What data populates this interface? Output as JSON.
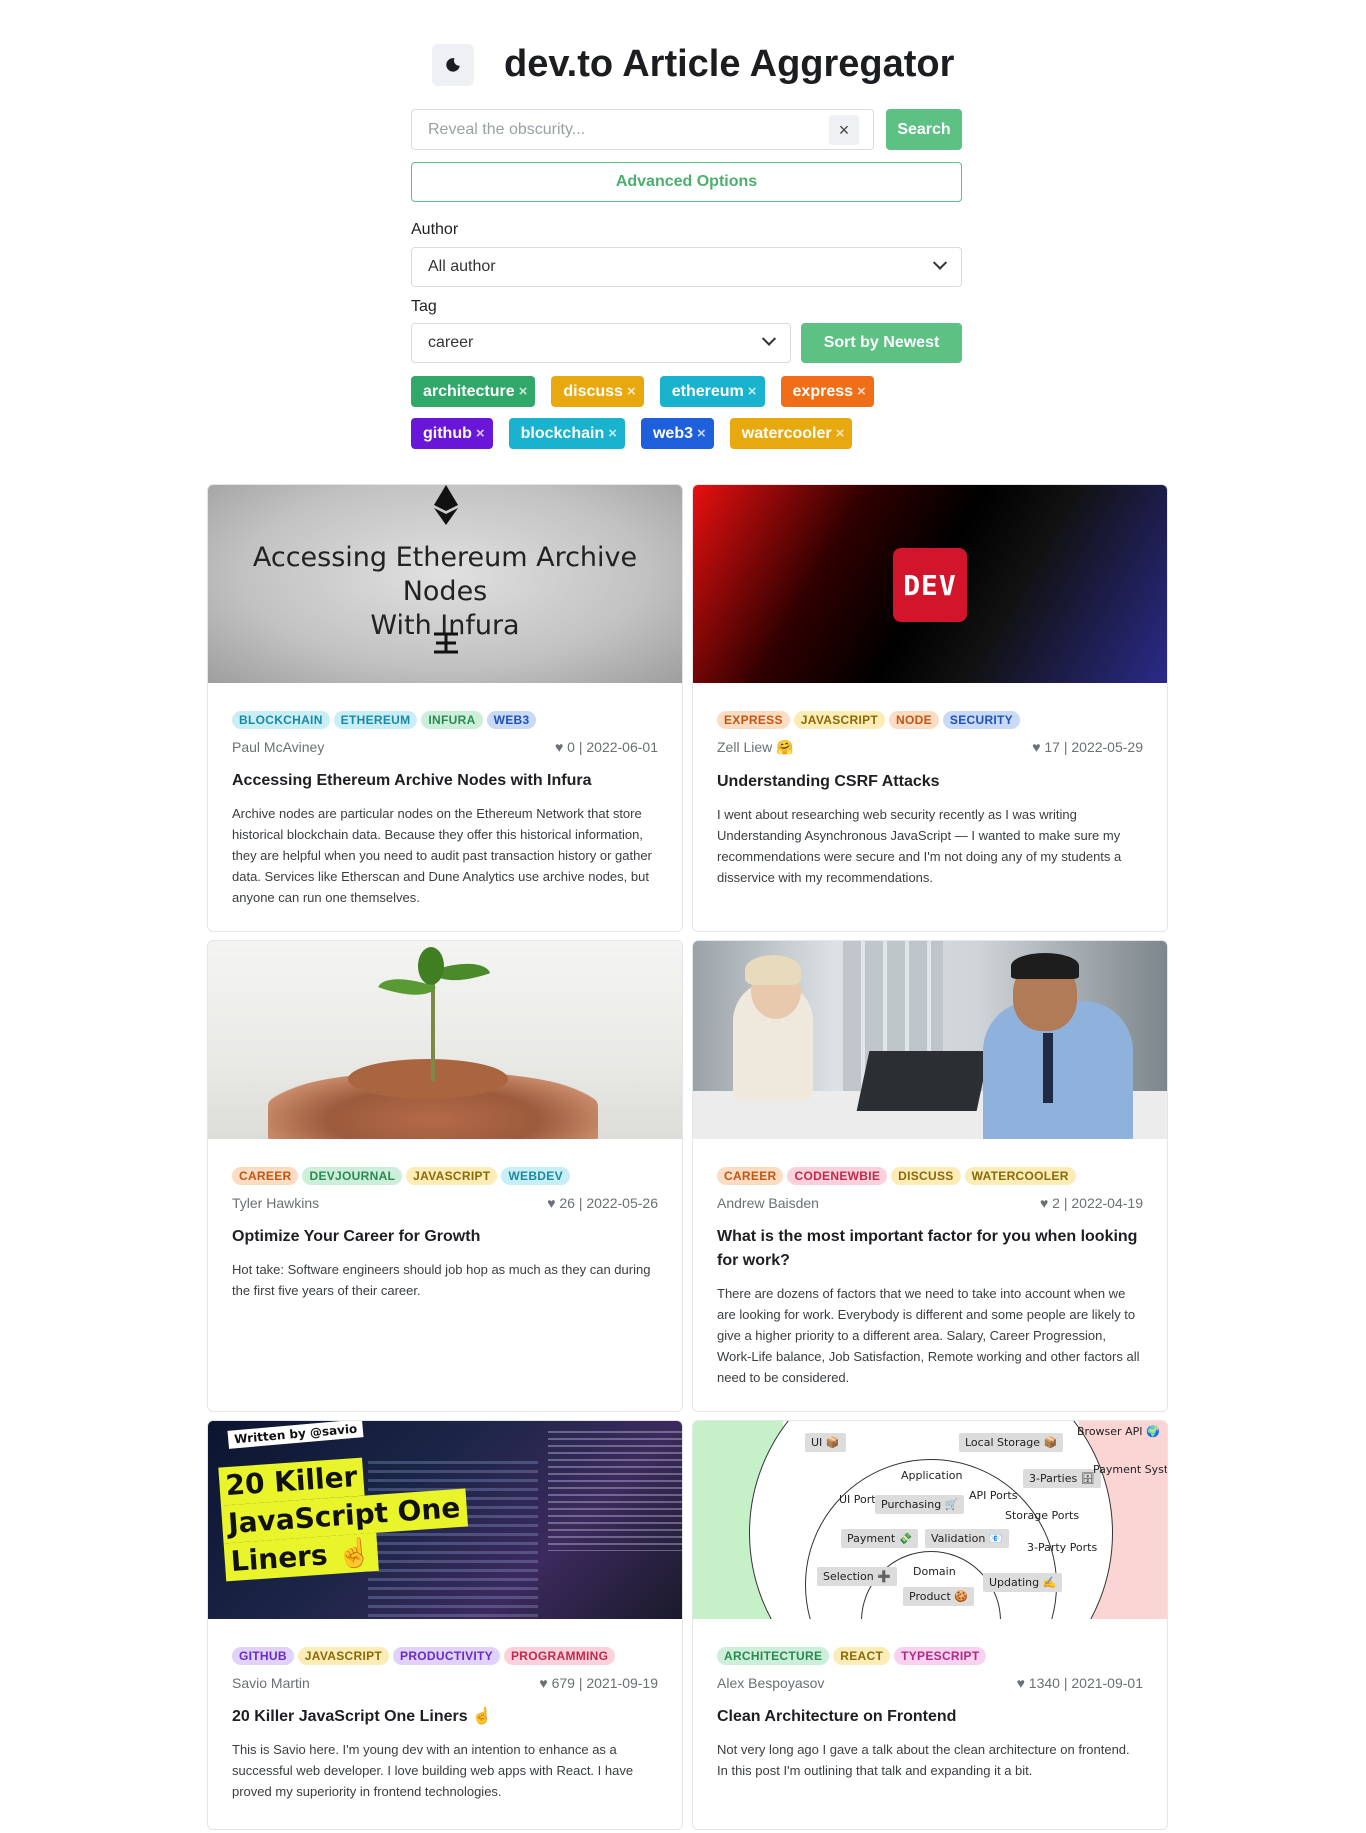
{
  "header": {
    "title": "dev.to Article Aggregator",
    "theme_icon": "moon-icon"
  },
  "search": {
    "placeholder": "Reveal the obscurity...",
    "value": "",
    "button_label": "Search",
    "clear_icon": "×"
  },
  "advanced": {
    "label": "Advanced Options"
  },
  "author": {
    "label": "Author",
    "selected": "All author"
  },
  "tag": {
    "label": "Tag",
    "selected": "career"
  },
  "sort": {
    "label": "Sort by Newest"
  },
  "active_tags": [
    {
      "label": "architecture",
      "color": "#2fa86a"
    },
    {
      "label": "discuss",
      "color": "#e8a90f"
    },
    {
      "label": "ethereum",
      "color": "#1ab3cf"
    },
    {
      "label": "express",
      "color": "#f06e17"
    },
    {
      "label": "github",
      "color": "#6a16d9"
    },
    {
      "label": "blockchain",
      "color": "#1ab3cf"
    },
    {
      "label": "web3",
      "color": "#1e5fdc"
    },
    {
      "label": "watercooler",
      "color": "#e8a90f"
    }
  ],
  "tag_remove": "×",
  "articles": [
    {
      "tags": [
        "BLOCKCHAIN",
        "ETHEREUM",
        "INFURA",
        "WEB3"
      ],
      "author": "Paul McAviney",
      "stats": "♥ 0 | 2022-06-01",
      "title": "Accessing Ethereum Archive Nodes with Infura",
      "description": "Archive nodes are particular nodes on the Ethereum Network that store historical blockchain data. Because they offer this historical information, they are helpful when you need to audit past transaction history or gather data. Services like Etherscan and Dune Analytics use archive nodes, but anyone can run one themselves.",
      "cover_text": [
        "Accessing Ethereum Archive Nodes",
        "With Infura"
      ]
    },
    {
      "tags": [
        "EXPRESS",
        "JAVASCRIPT",
        "NODE",
        "SECURITY"
      ],
      "author": "Zell Liew 🤗",
      "stats": "♥ 17 | 2022-05-29",
      "title": "Understanding CSRF Attacks",
      "description": "I went about researching web security recently as I was writing Understanding Asynchronous JavaScript — I wanted to make sure my recommendations were secure and I'm not doing any of my students a disservice with my recommendations.",
      "cover_text": [
        "DEV"
      ]
    },
    {
      "tags": [
        "CAREER",
        "DEVJOURNAL",
        "JAVASCRIPT",
        "WEBDEV"
      ],
      "author": "Tyler Hawkins",
      "stats": "♥ 26 | 2022-05-26",
      "title": "Optimize Your Career for Growth",
      "description": "Hot take: Software engineers should job hop as much as they can during the first five years of their career.",
      "cover_text": []
    },
    {
      "tags": [
        "CAREER",
        "CODENEWBIE",
        "DISCUSS",
        "WATERCOOLER"
      ],
      "author": "Andrew Baisden",
      "stats": "♥ 2 | 2022-04-19",
      "title": "What is the most important factor for you when looking for work?",
      "description": "There are dozens of factors that we need to take into account when we are looking for work. Everybody is different and some people are likely to give a higher priority to a different area. Salary, Career Progression, Work-Life balance, Job Satisfaction, Remote working and other factors all need to be considered.",
      "cover_text": []
    },
    {
      "tags": [
        "GITHUB",
        "JAVASCRIPT",
        "PRODUCTIVITY",
        "PROGRAMMING"
      ],
      "author": "Savio Martin",
      "stats": "♥ 679 | 2021-09-19",
      "title": "20 Killer JavaScript One Liners ☝️",
      "description": "This is Savio here. I'm young dev with an intention to enhance as a successful web developer. I love building web apps with React. I have proved my superiority in frontend technologies.",
      "cover_text": [
        "Written by @savio",
        "20 Killer",
        "JavaScript One",
        "Liners ☝️"
      ]
    },
    {
      "tags": [
        "ARCHITECTURE",
        "REACT",
        "TYPESCRIPT"
      ],
      "author": "Alex Bespoyasov",
      "stats": "♥ 1340 | 2021-09-01",
      "title": "Clean Architecture on Frontend",
      "description": "Not very long ago I gave a talk about the clean architecture on frontend. In this post I'm outlining that talk and expanding it a bit.",
      "cover_text": [
        "UI 📦",
        "Local Storage 📦",
        "Browser API 🌍",
        "Application",
        "3-Parties 🗄",
        "Payment System 💳",
        "UI Ports",
        "API Ports",
        "Purchasing 🛒",
        "Storage Ports",
        "Payment 💸",
        "Validation 📧",
        "3-Party Ports",
        "Selection ➕",
        "Domain",
        "Updating ✍️",
        "Product 🍪"
      ]
    }
  ],
  "tag_colors": {
    "BLOCKCHAIN": [
      "#c9eef6",
      "#1a8aa3"
    ],
    "ETHEREUM": [
      "#c9eef6",
      "#1a8aa3"
    ],
    "INFURA": [
      "#cdeed9",
      "#2a8a52"
    ],
    "WEB3": [
      "#c9d9f8",
      "#2250b8"
    ],
    "EXPRESS": [
      "#fddcc4",
      "#c25510"
    ],
    "JAVASCRIPT": [
      "#fbecb8",
      "#8a6a06"
    ],
    "NODE": [
      "#fddcc4",
      "#c25510"
    ],
    "SECURITY": [
      "#c9d9f8",
      "#2250b8"
    ],
    "CAREER": [
      "#fddcc4",
      "#c25510"
    ],
    "DEVJOURNAL": [
      "#cdeed9",
      "#2a8a52"
    ],
    "WEBDEV": [
      "#c9eef6",
      "#1a8aa3"
    ],
    "CODENEWBIE": [
      "#fbd2dc",
      "#c0294e"
    ],
    "DISCUSS": [
      "#fbecb8",
      "#8a6a06"
    ],
    "WATERCOOLER": [
      "#fbecb8",
      "#8a6a06"
    ],
    "GITHUB": [
      "#e0d2f8",
      "#6a2bc4"
    ],
    "PRODUCTIVITY": [
      "#e0d2f8",
      "#6a2bc4"
    ],
    "PROGRAMMING": [
      "#fbd2dc",
      "#c0294e"
    ],
    "ARCHITECTURE": [
      "#cdeed9",
      "#2a8a52"
    ],
    "REACT": [
      "#fbecb8",
      "#8a6a06"
    ],
    "TYPESCRIPT": [
      "#f8d2ee",
      "#b02a8a"
    ]
  }
}
